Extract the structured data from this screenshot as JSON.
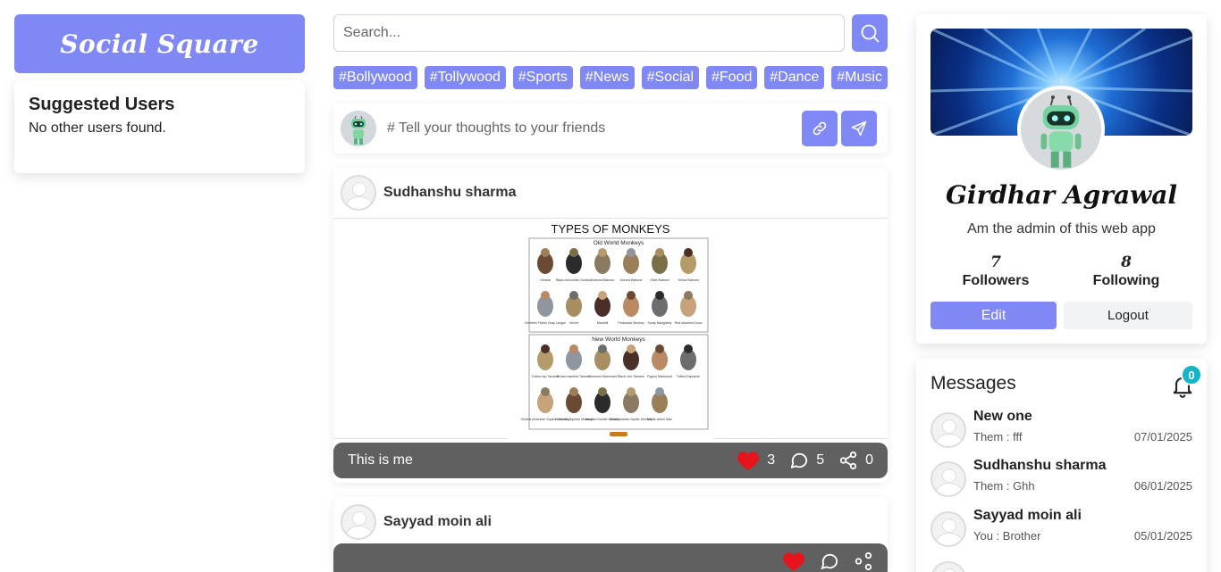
{
  "brand": {
    "title": "Social Square"
  },
  "suggested": {
    "title": "Suggested Users",
    "empty_text": "No other users found."
  },
  "search": {
    "placeholder": "Search..."
  },
  "tags": [
    "#Bollywood",
    "#Tollywood",
    "#Sports",
    "#News",
    "#Social",
    "#Food",
    "#Dance",
    "#Music"
  ],
  "composer": {
    "placeholder": "# Tell your thoughts to your friends"
  },
  "posts": [
    {
      "author": "Sudhanshu sharma",
      "caption": "This is me",
      "likes": "3",
      "comments": "5",
      "shares": "0",
      "image": {
        "title": "TYPES OF MONKEYS",
        "section1": "Old World Monkeys",
        "section2": "New World Monkeys",
        "old_world": [
          "Gelada",
          "Black-and-white Colobus",
          "Chacma Baboon",
          "Guinea Baboon",
          "Olive Baboon",
          "Yellow Baboon",
          "Northern Plains Gray Langur",
          "Vervet",
          "Mandrill",
          "Proboscis Monkey",
          "Sooty Mangabey",
          "Red-shanked Douc"
        ],
        "new_world": [
          "Cotton-top Tamarin",
          "Brown-mantled Tamarin",
          "Common Marmoset",
          "Black Lion Tamarin",
          "Pygmy Marmoset",
          "Tufted Capuchin",
          "Central American Squirrel Monkey",
          "Common Squirrel Monkey",
          "Mantled Howler Monkey",
          "Black-headed Spider Monkey",
          "White-faced Saki"
        ]
      }
    },
    {
      "author": "Sayyad moin ali"
    }
  ],
  "profile": {
    "name": "Girdhar Agrawal",
    "bio": "Am the admin of this web app",
    "followers_count": "7",
    "followers_label": "Followers",
    "following_count": "8",
    "following_label": "Following",
    "edit_label": "Edit",
    "logout_label": "Logout"
  },
  "messages": {
    "title": "Messages",
    "badge": "0",
    "items": [
      {
        "name": "New one",
        "preview": "Them : fff",
        "date": "07/01/2025"
      },
      {
        "name": "Sudhanshu sharma",
        "preview": "Them : Ghh",
        "date": "06/01/2025"
      },
      {
        "name": "Sayyad moin ali",
        "preview": "You : Brother",
        "date": "05/01/2025"
      }
    ]
  },
  "colors": {
    "accent": "#7f88f4",
    "footer_bar": "#606060",
    "like": "#e8141c",
    "badge": "#13b5c8"
  },
  "icons": [
    "search-icon",
    "link-icon",
    "send-icon",
    "heart-icon",
    "comment-icon",
    "share-icon",
    "bell-icon"
  ]
}
